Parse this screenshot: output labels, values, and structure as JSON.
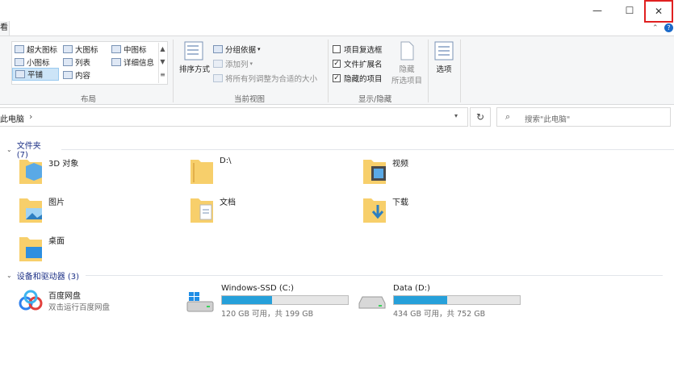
{
  "window": {
    "minimize_glyph": "—",
    "maximize_glyph": "☐",
    "close_glyph": "✕",
    "help_glyph": "?",
    "collapse_glyph": "⌃"
  },
  "tab": {
    "label": "看"
  },
  "ribbon": {
    "layout": {
      "items": [
        "超大图标",
        "大图标",
        "中图标",
        "小图标",
        "列表",
        "详细信息",
        "平铺",
        "内容"
      ],
      "group_label": "布局"
    },
    "current_view": {
      "sort_label": "排序方式",
      "group_by_label": "分组依据",
      "add_column_label": "添加列",
      "fit_columns_label": "将所有列调整为合适的大小",
      "group_label": "当前视图"
    },
    "show_hide": {
      "item_checkboxes": {
        "label": "项目复选框",
        "checked": false
      },
      "file_extensions": {
        "label": "文件扩展名",
        "checked": true
      },
      "hidden_items": {
        "label": "隐藏的项目",
        "checked": true
      },
      "hide_selected_label_1": "隐藏",
      "hide_selected_label_2": "所选项目",
      "group_label": "显示/隐藏"
    },
    "options": {
      "label": "选项"
    }
  },
  "address": {
    "path": "此电脑",
    "chevron": "›",
    "refresh_glyph": "↻",
    "search_placeholder": "搜索\"此电脑\""
  },
  "folders_section": {
    "title": "文件夹 (7)",
    "items": [
      "3D 对象",
      "D:\\",
      "视频",
      "图片",
      "文档",
      "下载",
      "桌面"
    ]
  },
  "devices_section": {
    "title": "设备和驱动器 (3)",
    "baidu": {
      "name": "百度网盘",
      "sub": "双击运行百度网盘"
    },
    "drives": [
      {
        "name": "Windows-SSD (C:)",
        "free": "120 GB 可用，共 199 GB",
        "used_fraction": 0.397
      },
      {
        "name": "Data (D:)",
        "free": "434 GB 可用，共 752 GB",
        "used_fraction": 0.423
      }
    ]
  },
  "colors": {
    "accent": "#26a0da",
    "close_highlight": "#e02020",
    "folder": "#f7cf6b"
  }
}
